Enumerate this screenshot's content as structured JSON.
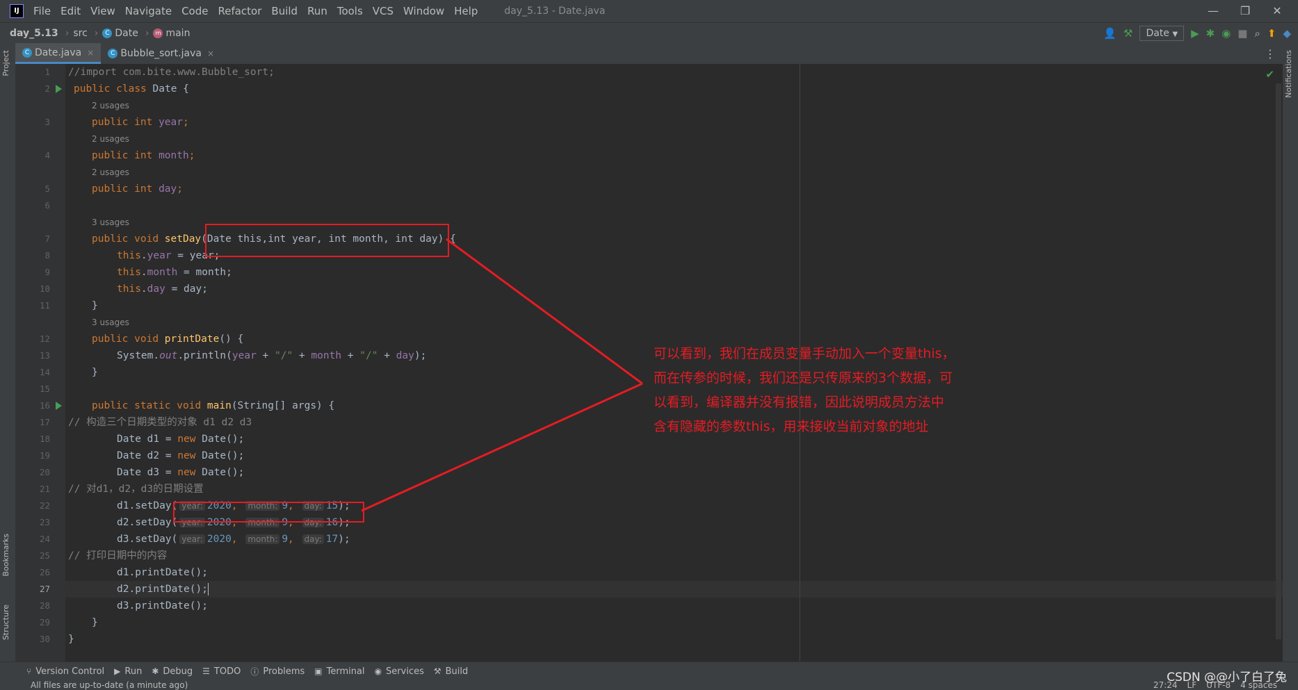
{
  "menubar": {
    "items": [
      "File",
      "Edit",
      "View",
      "Navigate",
      "Code",
      "Refactor",
      "Build",
      "Run",
      "Tools",
      "VCS",
      "Window",
      "Help"
    ],
    "window_title": "day_5.13 - Date.java",
    "controls": [
      "—",
      "❐",
      "✕"
    ]
  },
  "navbar": {
    "project": "day_5.13",
    "src": "src",
    "class_name": "Date",
    "method_name": "main",
    "run_config": "Date",
    "run_config_arrow": "▼"
  },
  "side": {
    "project": "Project",
    "bookmarks": "Bookmarks",
    "structure": "Structure",
    "notifications": "Notifications"
  },
  "tabs": [
    {
      "label": "Date.java",
      "close": "×"
    },
    {
      "label": "Bubble_sort.java",
      "close": "×"
    }
  ],
  "editor": {
    "line_numbers": [
      "1",
      "2",
      "3",
      "4",
      "5",
      "6",
      "7",
      "8",
      "9",
      "10",
      "11",
      "12",
      "13",
      "14",
      "15",
      "16",
      "17",
      "18",
      "19",
      "20",
      "21",
      "22",
      "23",
      "24",
      "25",
      "26",
      "27",
      "28",
      "29",
      "30"
    ],
    "usages": [
      "2 usages",
      "2 usages",
      "2 usages",
      "3 usages",
      "3 usages"
    ],
    "code": {
      "l1": "//import com.bite.www.Bubble_sort;",
      "public": "public",
      "class": "class",
      "int": "int",
      "void": "void",
      "static": "static",
      "new": "new",
      "this": "this",
      "date_brace": " Date {",
      "year": "year",
      "month": "month",
      "day": "day",
      "semi": ";",
      "set_day": "setDay",
      "date_type": "Date ",
      "l7_params": "(Date this,int year, int month, int day) {",
      "assign_year": " = year;",
      "assign_month": " = month;",
      "assign_day": " = day;",
      "close_brace": "}",
      "print_date": "printDate",
      "empty_parens": "() {",
      "system_out": "System.",
      "out": "out",
      "println_open": ".println(",
      "slash_str": "\"/\"",
      "plus": " + ",
      "println_close": ");",
      "main": "main",
      "main_params": "(String[] args) {",
      "c17": "// 构造三个日期类型的对象 d1 d2 d3",
      "d1_decl": "Date d1 = ",
      "d2_decl": "Date d2 = ",
      "d3_decl": "Date d3 = ",
      "new_date": " Date();",
      "c21": "// 对d1，d2，d3的日期设置",
      "d1_set": "d1.setDay(",
      "d2_set": "d2.setDay(",
      "d3_set": "d3.setDay(",
      "hint_year": "year:",
      "hint_month": "month:",
      "hint_day": "day:",
      "v2020": "2020",
      "v9": "9",
      "v15": "15",
      "v16": "16",
      "v17": "17",
      "comma": ",",
      "call_close": ");",
      "c25": "// 打印日期中的内容",
      "d1_print": "d1.printDate();",
      "d2_print": "d2.printDate();",
      "d3_print": "d3.printDate();"
    }
  },
  "annotation": {
    "lines": [
      "可以看到，我们在成员变量手动加入一个变量this，",
      "而在传参的时候，我们还是只传原来的3个数据，可",
      "以看到，编译器并没有报错，因此说明成员方法中",
      "含有隐藏的参数this，用来接收当前对象的地址"
    ],
    "color": "#e51c23"
  },
  "bottom_tools": [
    "Version Control",
    "Run",
    "Debug",
    "TODO",
    "Problems",
    "Terminal",
    "Services",
    "Build"
  ],
  "status": {
    "message": "All files are up-to-date (a minute ago)",
    "right": [
      "27:24",
      "LF",
      "UTF-8",
      "4 spaces"
    ]
  },
  "watermark": "CSDN @@小了白了兔"
}
